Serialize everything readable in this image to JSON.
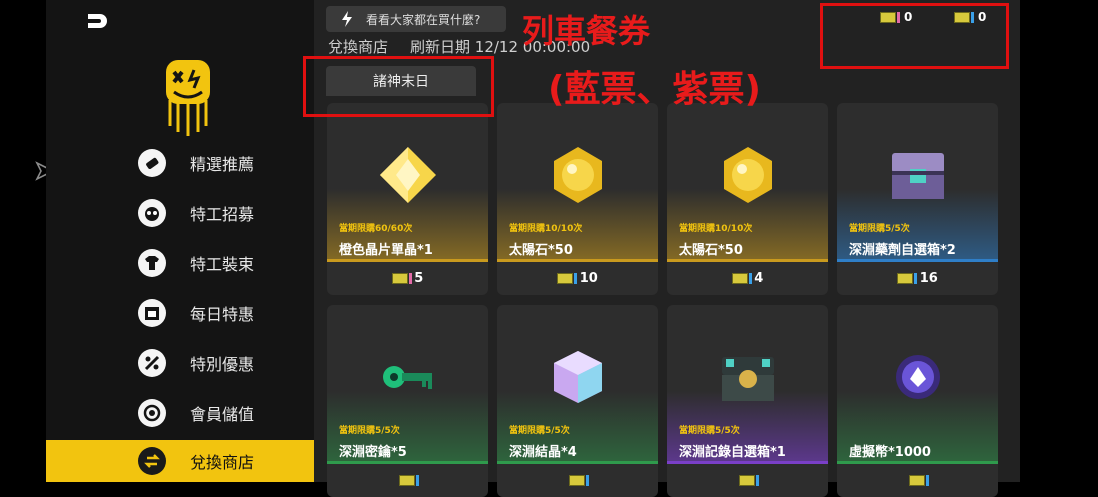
{
  "tip": {
    "text": "看看大家都在買什麼?"
  },
  "shop": {
    "title": "兌換商店",
    "refresh": "刷新日期 12/12 00:00:00"
  },
  "tab": {
    "label": "諸神末日"
  },
  "annotation": {
    "line1": "列車餐券",
    "line2": "(藍票、紫票)"
  },
  "currency": {
    "purple": "0",
    "blue": "0"
  },
  "nav": [
    {
      "label": "精選推薦"
    },
    {
      "label": "特工招募"
    },
    {
      "label": "特工裝束"
    },
    {
      "label": "每日特惠"
    },
    {
      "label": "特別優惠"
    },
    {
      "label": "會員儲值"
    },
    {
      "label": "兌換商店"
    }
  ],
  "cards": [
    {
      "limit": "當期限購60/60次",
      "name": "橙色晶片單晶*1",
      "price": "5",
      "ticket": "purple",
      "accent": "#c99a1e"
    },
    {
      "limit": "當期限購10/10次",
      "name": "太陽石*50",
      "price": "10",
      "ticket": "blue",
      "accent": "#c99a1e"
    },
    {
      "limit": "當期限購10/10次",
      "name": "太陽石*50",
      "price": "4",
      "ticket": "blue",
      "accent": "#c99a1e"
    },
    {
      "limit": "當期限購5/5次",
      "name": "深淵藥劑自選箱*2",
      "price": "16",
      "ticket": "blue",
      "accent": "#2f7fc8"
    },
    {
      "limit": "當期限購5/5次",
      "name": "深淵密鑰*5",
      "price": "",
      "ticket": "blue",
      "accent": "#2f9a4c"
    },
    {
      "limit": "當期限購5/5次",
      "name": "深淵結晶*4",
      "price": "",
      "ticket": "blue",
      "accent": "#2f9a4c"
    },
    {
      "limit": "當期限購5/5次",
      "name": "深淵記錄自選箱*1",
      "price": "",
      "ticket": "blue",
      "accent": "#7a3fc8"
    },
    {
      "limit": "",
      "name": "虛擬幣*1000",
      "price": "",
      "ticket": "blue",
      "accent": "#2f9a4c"
    }
  ]
}
